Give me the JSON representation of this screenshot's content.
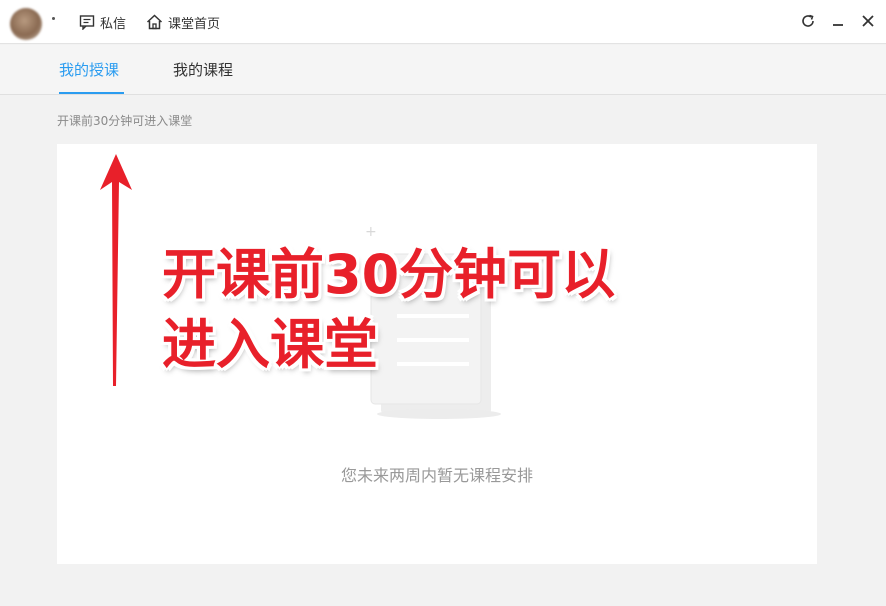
{
  "titlebar": {
    "messages_label": "私信",
    "home_label": "课堂首页"
  },
  "tabs": [
    {
      "label": "我的授课",
      "active": true
    },
    {
      "label": "我的课程",
      "active": false
    }
  ],
  "hint": "开课前30分钟可进入课堂",
  "empty_state": {
    "text": "您未来两周内暂无课程安排"
  },
  "annotation": {
    "line1": "开课前30分钟可以",
    "line2": "进入课堂"
  },
  "colors": {
    "accent": "#2a9cf0",
    "annotation": "#e8202a"
  },
  "icons": {
    "messages": "message-icon",
    "home": "home-icon",
    "refresh": "refresh-icon",
    "minimize": "minimize-icon",
    "close": "close-icon"
  }
}
